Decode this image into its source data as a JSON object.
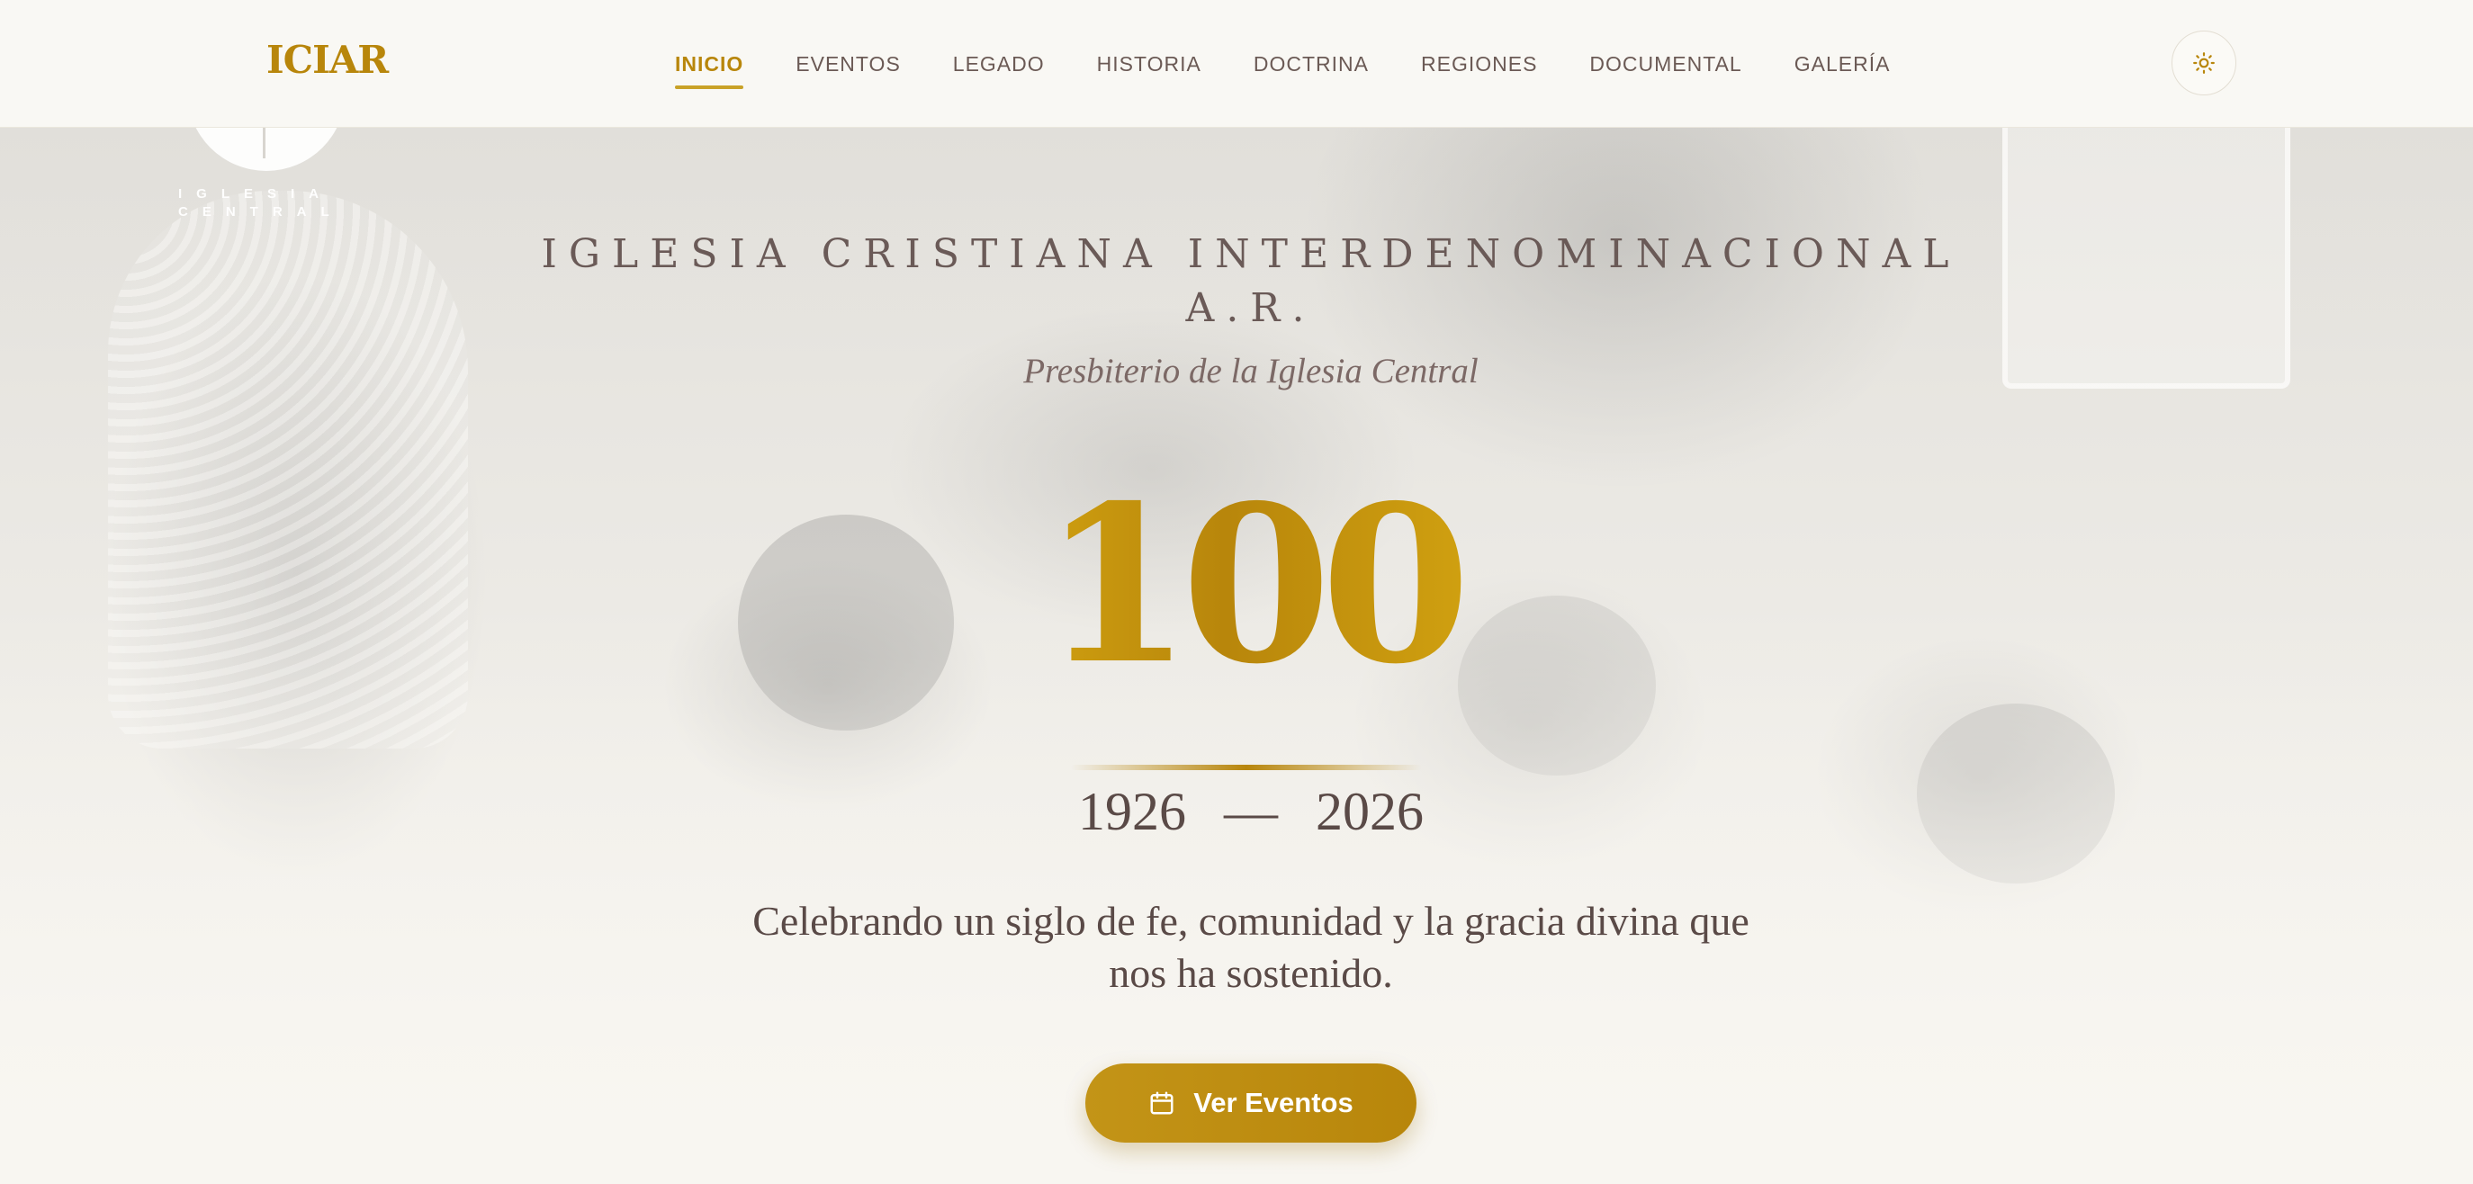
{
  "header": {
    "logo": "ICIAR",
    "nav": [
      {
        "label": "INICIO",
        "active": true
      },
      {
        "label": "EVENTOS"
      },
      {
        "label": "LEGADO"
      },
      {
        "label": "HISTORIA"
      },
      {
        "label": "DOCTRINA"
      },
      {
        "label": "REGIONES"
      },
      {
        "label": "DOCUMENTAL"
      },
      {
        "label": "GALERÍA"
      }
    ],
    "theme_toggle_icon": "sun-icon"
  },
  "watermark": {
    "line1": "IGLESIA",
    "line2": "CENTRAL"
  },
  "hero": {
    "church_name_line1": "IGLESIA CRISTIANA INTERDENOMINACIONAL",
    "church_name_line2": "A.R.",
    "subtitle": "Presbiterio de la Iglesia Central",
    "centenary": "100",
    "year_start": "1926",
    "year_separator": "—",
    "year_end": "2026",
    "tagline_line1": "Celebrando un siglo de fe, comunidad y la gracia divina que",
    "tagline_line2": "nos ha sostenido.",
    "cta_label": "Ver Eventos",
    "cta_icon": "calendar-icon"
  },
  "colors": {
    "accent": "#b8860b",
    "accent_light": "#d4a511",
    "text": "#5a4a47",
    "background": "#f8f6f1"
  }
}
